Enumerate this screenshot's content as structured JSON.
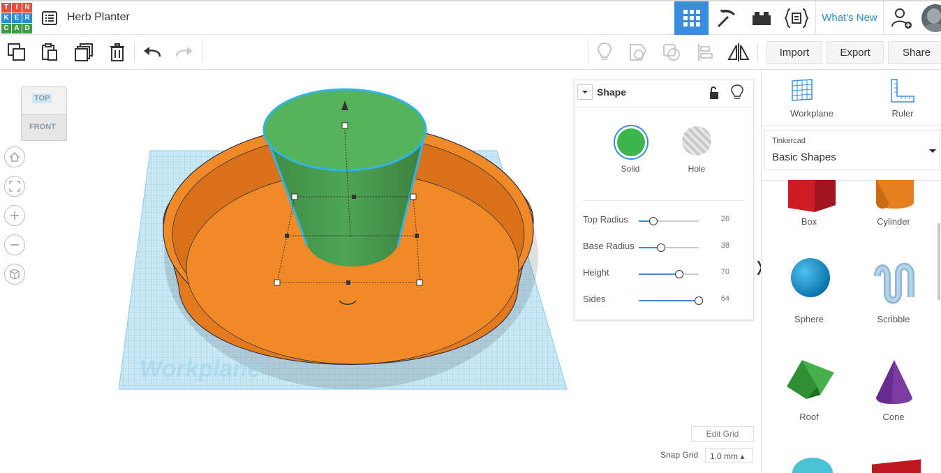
{
  "logo": {
    "letters": [
      "T",
      "I",
      "N",
      "K",
      "E",
      "R",
      "C",
      "A",
      "D"
    ],
    "colors": [
      "#e84d3d",
      "#e84d3d",
      "#e84d3d",
      "#2a8fcf",
      "#2a8fcf",
      "#2a8fcf",
      "#3f9a44",
      "#3f9a44",
      "#3f9a44"
    ]
  },
  "header": {
    "title": "Herb Planter",
    "whats_new": "What's New",
    "icons": [
      "grid-view-icon",
      "pickaxe-icon",
      "bricks-icon",
      "codeblocks-icon",
      "add-user-icon",
      "avatar"
    ]
  },
  "toolbar": {
    "tools": [
      "copy-icon",
      "paste-icon",
      "duplicate-icon",
      "delete-icon",
      "undo-icon",
      "redo-icon"
    ],
    "view_tools": [
      "light-bulb-icon",
      "note-icon",
      "group-icon",
      "align-icon",
      "mirror-icon"
    ],
    "import_label": "Import",
    "export_label": "Export",
    "share_label": "Share"
  },
  "viewcube": {
    "top": "TOP",
    "front": "FRONT"
  },
  "viewport": {
    "workplane_watermark": "Workplane",
    "edit_grid": "Edit Grid",
    "snap_grid_label": "Snap Grid",
    "snap_grid_value": "1.0 mm ▴"
  },
  "shape_panel": {
    "title": "Shape",
    "solid_label": "Solid",
    "hole_label": "Hole",
    "solid_color": "#3cb64b",
    "properties": [
      {
        "label": "Top Radius",
        "value": "26",
        "fraction": 0.24
      },
      {
        "label": "Base Radius",
        "value": "38",
        "fraction": 0.37
      },
      {
        "label": "Height",
        "value": "70",
        "fraction": 0.68
      },
      {
        "label": "Sides",
        "value": "64",
        "fraction": 1.0
      }
    ]
  },
  "right_panel": {
    "workplane_label": "Workplane",
    "ruler_label": "Ruler",
    "library_category": "Tinkercad",
    "library_name": "Basic Shapes",
    "shapes": [
      {
        "label": "Box",
        "icon": "box-shape-icon"
      },
      {
        "label": "Cylinder",
        "icon": "cylinder-shape-icon"
      },
      {
        "label": "Sphere",
        "icon": "sphere-shape-icon"
      },
      {
        "label": "Scribble",
        "icon": "scribble-shape-icon"
      },
      {
        "label": "Roof",
        "icon": "roof-shape-icon"
      },
      {
        "label": "Cone",
        "icon": "cone-shape-icon"
      }
    ]
  },
  "colors": {
    "accent": "#2a8fcf",
    "planter_orange": "#ed8322",
    "pot_green": "#55b35b",
    "selection": "#2fb5e8",
    "workplane_blue": "#aedcf0"
  }
}
